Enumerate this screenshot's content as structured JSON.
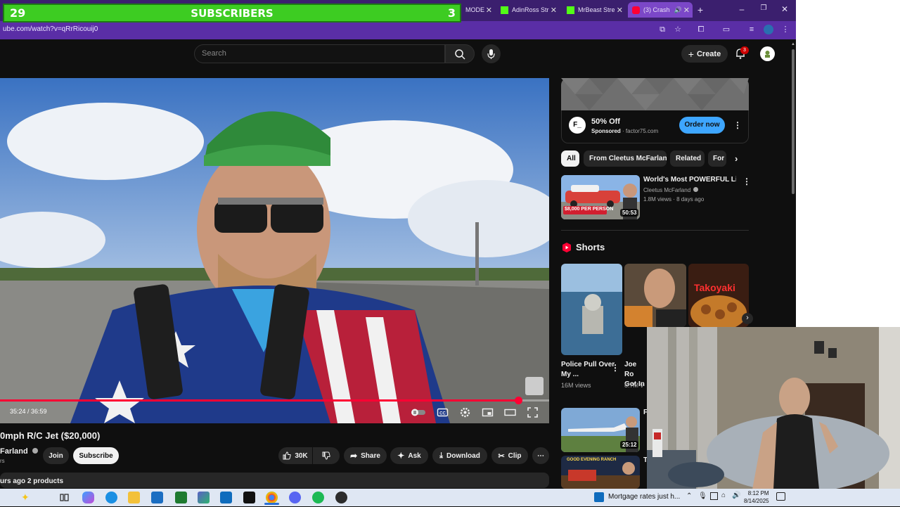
{
  "overlay": {
    "count_left": "29",
    "label": "SUBSCRIBERS",
    "count_right": "3"
  },
  "browser": {
    "tabs": [
      {
        "label": "MODE"
      },
      {
        "label": "AdinRoss Str"
      },
      {
        "label": "MrBeast Stre"
      },
      {
        "label": "(3) Crash"
      }
    ],
    "new_tab": "+",
    "url": "ube.com/watch?v=qRrRicouij0"
  },
  "youtube": {
    "search_placeholder": "Search",
    "create_label": "Create",
    "notification_count": "3"
  },
  "player": {
    "current_time": "35:24",
    "duration": "36:59",
    "time_display": "35:24 / 36:59",
    "progress": 0.944
  },
  "video": {
    "title": "0mph R/C Jet ($20,000)",
    "channel": "Farland",
    "subscribers": "rs",
    "join_label": "Join",
    "subscribe_label": "Subscribe",
    "likes": "30K",
    "share_label": "Share",
    "ask_label": "Ask",
    "download_label": "Download",
    "clip_label": "Clip",
    "description_line": "urs ago  2 products"
  },
  "ad": {
    "logo": "F_",
    "title": "50% Off",
    "sponsored": "Sponsored",
    "domain": "· factor75.com",
    "cta": "Order now"
  },
  "chips": [
    {
      "label": "All",
      "selected": true
    },
    {
      "label": "From Cleetus McFarland",
      "selected": false
    },
    {
      "label": "Related",
      "selected": false
    },
    {
      "label": "For",
      "selected": false
    }
  ],
  "recommended": [
    {
      "title": "World's Most POWERFUL Limo!",
      "channel": "Cleetus McFarland",
      "meta": "1.8M views · 8 days ago",
      "duration": "50:53",
      "thumb_text": "$8,000 PER PERSON"
    },
    {
      "title": "F",
      "channel": "",
      "meta": "",
      "duration": "25:12",
      "thumb_text": ""
    },
    {
      "title": "T",
      "channel": "",
      "meta": "",
      "duration": "",
      "thumb_text": "GOOD EVENING RANCH"
    }
  ],
  "shorts": {
    "heading": "Shorts",
    "items": [
      {
        "title": "Police Pull Over My ...",
        "views": "16M views"
      },
      {
        "title": "Joe Ro Got In",
        "views": "8.7M v"
      },
      {
        "title": "",
        "views": "",
        "thumb_text": "Takoyaki"
      }
    ]
  },
  "taskbar": {
    "news": "Mortgage rates just h...",
    "time": "8:12 PM",
    "date": "8/14/2025"
  },
  "colors": {
    "youtube_bg": "#0f0f0f",
    "progress_red": "#ff0033",
    "overlay_green": "#3dcc22",
    "browser_purple": "#5a2ea6",
    "cta_blue": "#3ea6ff"
  }
}
